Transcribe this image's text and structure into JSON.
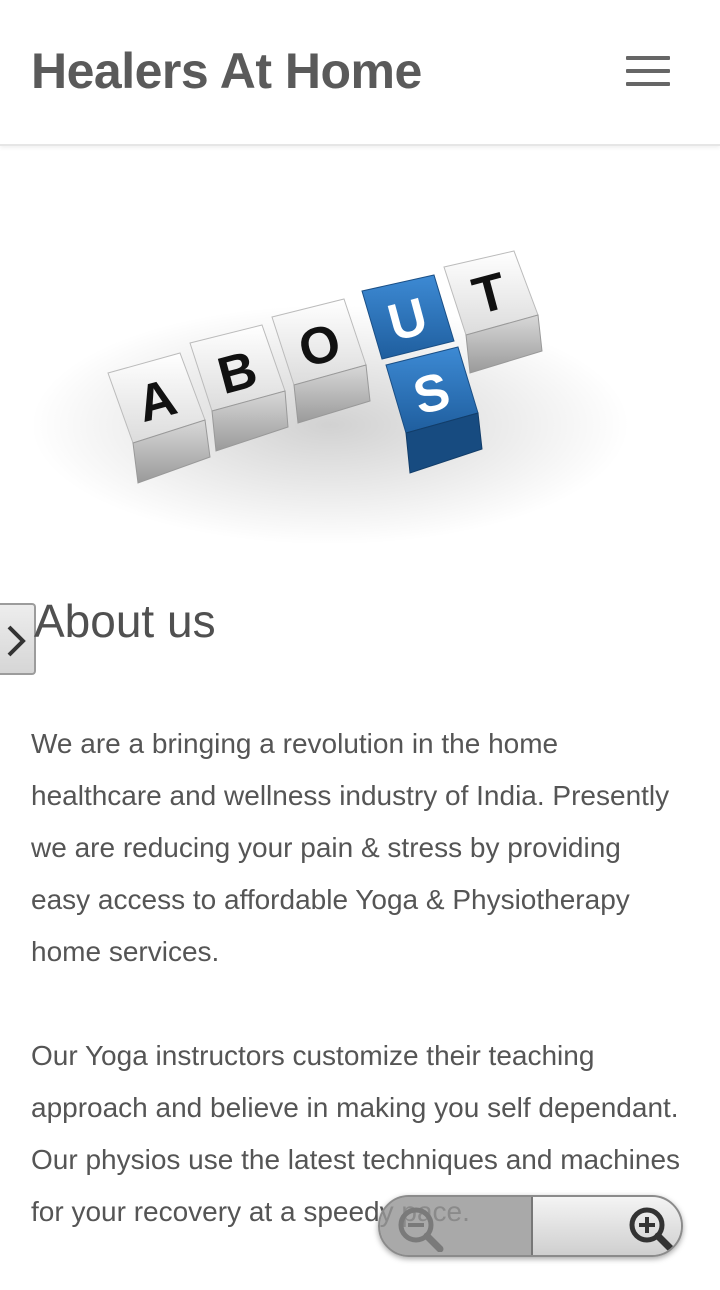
{
  "header": {
    "title": "Healers At Home",
    "menu_icon": "hamburger-menu-icon"
  },
  "hero": {
    "cube_letters_top": [
      "A",
      "B",
      "O",
      "U",
      "T"
    ],
    "cube_letters_vertical": [
      "S"
    ],
    "highlight_color": "#2f78c0"
  },
  "main": {
    "heading": "About us",
    "paragraphs": [
      "We are a bringing a revolution in the home healthcare and wellness industry of India. Presently we are reducing your pain & stress by providing easy access to affordable Yoga & Physiotherapy home services.",
      "Our Yoga instructors customize their teaching approach and believe in making you self dependant. Our physios use the latest techniques and machines for your recovery at a speedy pace."
    ]
  },
  "side_nav": {
    "icon": "chevron-right-icon"
  },
  "zoom": {
    "out_icon": "zoom-out-icon",
    "in_icon": "zoom-in-icon"
  }
}
